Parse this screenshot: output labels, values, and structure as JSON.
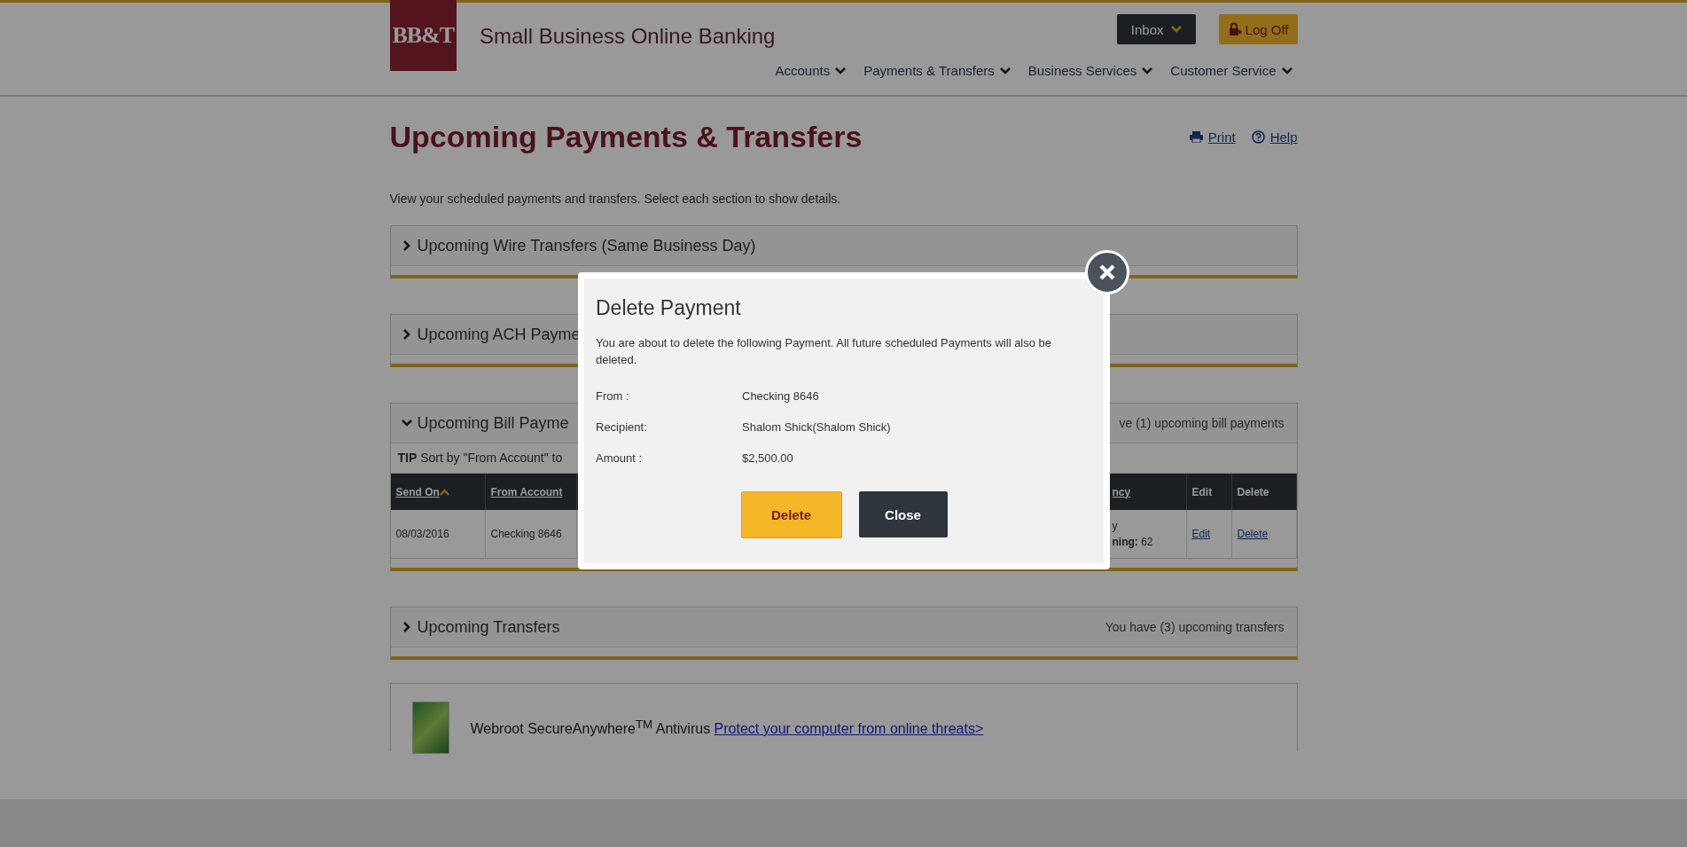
{
  "header": {
    "logo": "BB&T",
    "site_title": "Small Business Online Banking",
    "inbox_button": "Inbox",
    "logoff_button": "Log Off",
    "nav": [
      {
        "label": "Accounts"
      },
      {
        "label": "Payments & Transfers"
      },
      {
        "label": "Business Services"
      },
      {
        "label": "Customer Service"
      }
    ]
  },
  "page": {
    "title": "Upcoming Payments & Transfers",
    "print_link": "Print",
    "help_link": "Help",
    "intro": "View your scheduled payments and transfers. Select each section to show details."
  },
  "sections": [
    {
      "title": "Upcoming Wire Transfers (Same Business Day)",
      "expanded": false
    },
    {
      "title": "Upcoming ACH Payme",
      "expanded": false
    },
    {
      "title": "Upcoming Bill Payme",
      "expanded": true,
      "summary": "ve (1) upcoming bill payments",
      "tip": "**TIP** Sort by \"From Account\" to",
      "table": {
        "columns": [
          {
            "label": "Send On",
            "kind": "sortable",
            "sorted": true
          },
          {
            "label": "From Account",
            "kind": "sortable",
            "sorted": false
          },
          {
            "label": "ncy",
            "kind": "sortable",
            "sorted": false
          },
          {
            "label": "Edit",
            "kind": "plain",
            "sorted": false
          },
          {
            "label": "Delete",
            "kind": "plain",
            "sorted": false
          }
        ],
        "rows": [
          {
            "send_on": "08/03/2016",
            "from_account": "Checking 8646",
            "frequency": [
              "y",
              "**ning:** 62"
            ],
            "edit": "Edit",
            "delete": "Delete"
          }
        ]
      }
    },
    {
      "title": "Upcoming Transfers",
      "expanded": false,
      "summary": "You have (3) upcoming transfers"
    }
  ],
  "ad": {
    "text": "Webroot SecureAnywhere$^{TM}$ Antivirus",
    "link": "Protect your computer from online threats>"
  },
  "modal": {
    "title": "Delete Payment",
    "message": "You are about to delete the following Payment. All future scheduled Payments will also be deleted.",
    "fields": [
      {
        "label": "From :",
        "value": "Checking 8646"
      },
      {
        "label": "Recipient:",
        "value": "Shalom Shick(Shalom Shick)"
      },
      {
        "label": "Amount :",
        "value": "$2,500.00"
      }
    ],
    "buttons": [
      {
        "label": "Delete",
        "kind": "primary"
      },
      {
        "label": "Close",
        "kind": "secondary"
      }
    ]
  }
}
